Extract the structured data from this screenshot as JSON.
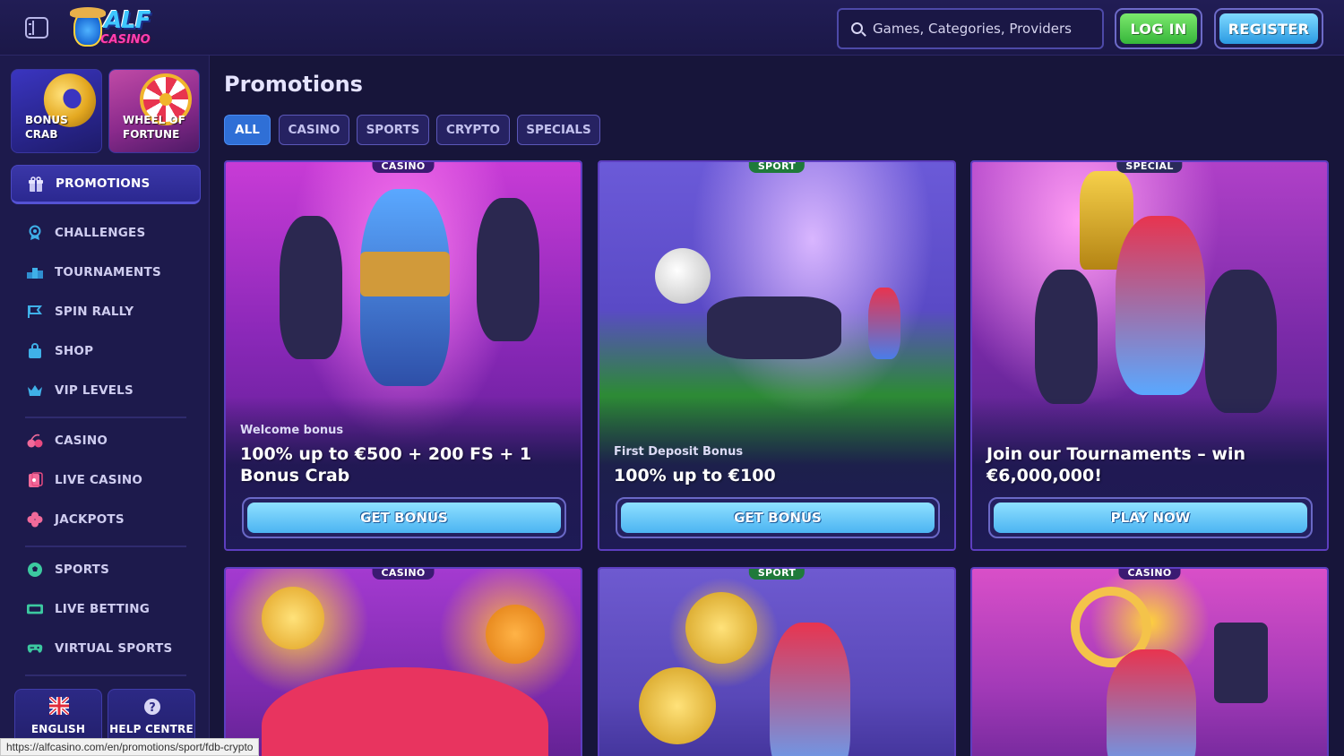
{
  "header": {
    "logo_text": "ALF",
    "logo_sub": "CASINO",
    "search_placeholder": "Games, Categories, Providers",
    "login_label": "LOG IN",
    "register_label": "REGISTER"
  },
  "sidebar": {
    "tiles": [
      {
        "line1": "BONUS",
        "line2": "CRAB"
      },
      {
        "line1": "WHEEL OF",
        "line2": "FORTUNE"
      }
    ],
    "active_item": "PROMOTIONS",
    "items": [
      {
        "label": "CHALLENGES",
        "icon": "challenges-icon"
      },
      {
        "label": "TOURNAMENTS",
        "icon": "tournaments-icon"
      },
      {
        "label": "SPIN RALLY",
        "icon": "spin-rally-icon"
      },
      {
        "label": "SHOP",
        "icon": "shop-icon"
      },
      {
        "label": "VIP LEVELS",
        "icon": "crown-icon"
      },
      {
        "label": "CASINO",
        "icon": "cherries-icon"
      },
      {
        "label": "LIVE CASINO",
        "icon": "live-casino-icon"
      },
      {
        "label": "JACKPOTS",
        "icon": "clover-icon"
      },
      {
        "label": "SPORTS",
        "icon": "sports-ball-icon"
      },
      {
        "label": "LIVE BETTING",
        "icon": "live-badge-icon"
      },
      {
        "label": "VIRTUAL SPORTS",
        "icon": "gamepad-icon"
      }
    ],
    "language_label": "ENGLISH",
    "help_label": "HELP CENTRE"
  },
  "main": {
    "title": "Promotions",
    "tabs": [
      "ALL",
      "CASINO",
      "SPORTS",
      "CRYPTO",
      "SPECIALS"
    ],
    "active_tab": "ALL",
    "cards": [
      {
        "badge": "CASINO",
        "kicker": "Welcome bonus",
        "title": "100% up to €500 + 200 FS + 1 Bonus Crab",
        "button": "GET BONUS"
      },
      {
        "badge": "SPORT",
        "kicker": "First Deposit Bonus",
        "title": "100% up to €100",
        "button": "GET BONUS"
      },
      {
        "badge": "SPECIAL",
        "kicker": "",
        "title": "Join our Tournaments – win €6,000,000!",
        "button": "PLAY NOW"
      },
      {
        "badge": "CASINO"
      },
      {
        "badge": "SPORT"
      },
      {
        "badge": "CASINO"
      }
    ]
  },
  "status_bar": {
    "url": "https://alfcasino.com/en/promotions/sport/fdb-crypto"
  },
  "colors": {
    "accent_blue": "#2f6fd6",
    "login_green": "#36b63a",
    "register_blue": "#2a9ae2",
    "background": "#17153a"
  }
}
